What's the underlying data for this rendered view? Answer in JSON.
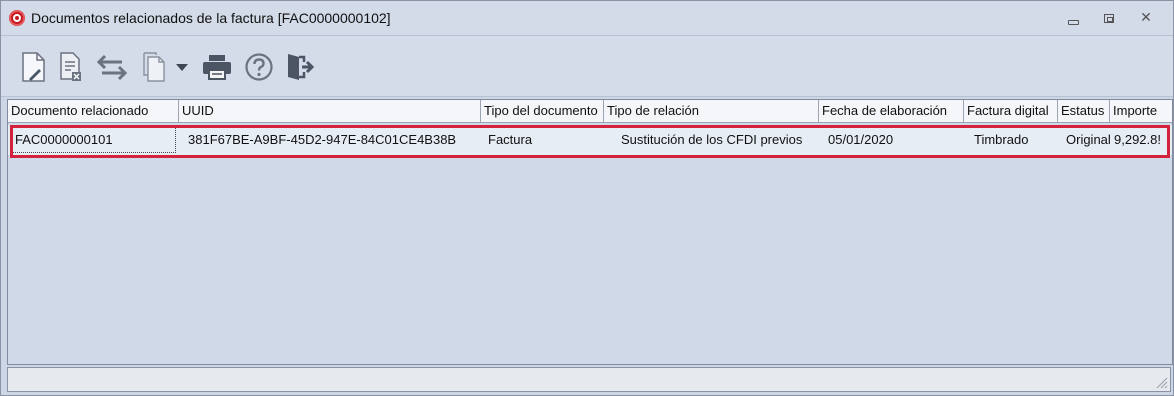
{
  "window": {
    "title": "Documentos relacionados de la factura [FAC0000000102]"
  },
  "toolbar": {
    "buttons": [
      {
        "icon": "new-document-icon"
      },
      {
        "icon": "delete-document-icon"
      },
      {
        "icon": "swap-arrows-icon"
      },
      {
        "icon": "copy-document-icon"
      },
      {
        "icon": "dropdown-arrow-icon"
      },
      {
        "icon": "print-icon"
      },
      {
        "icon": "help-icon"
      },
      {
        "icon": "exit-icon"
      }
    ]
  },
  "grid": {
    "columns": [
      "Documento relacionado",
      "UUID",
      "Tipo del documento",
      "Tipo de relación",
      "Fecha de elaboración",
      "Factura digital",
      "Estatus",
      "Importe"
    ],
    "rows": [
      {
        "documento": "FAC0000000101",
        "uuid": "381F67BE-A9BF-45D2-947E-84C01CE4B38B",
        "tipo_documento": "Factura",
        "tipo_relacion": "Sustitución de los CFDI previos",
        "fecha": "05/01/2020",
        "factura_digital": "Timbrado",
        "estatus": "Original",
        "importe": "9,292.8!"
      }
    ]
  },
  "colors": {
    "highlight": "#d4223c",
    "grid_background": "#cfd9e7"
  }
}
